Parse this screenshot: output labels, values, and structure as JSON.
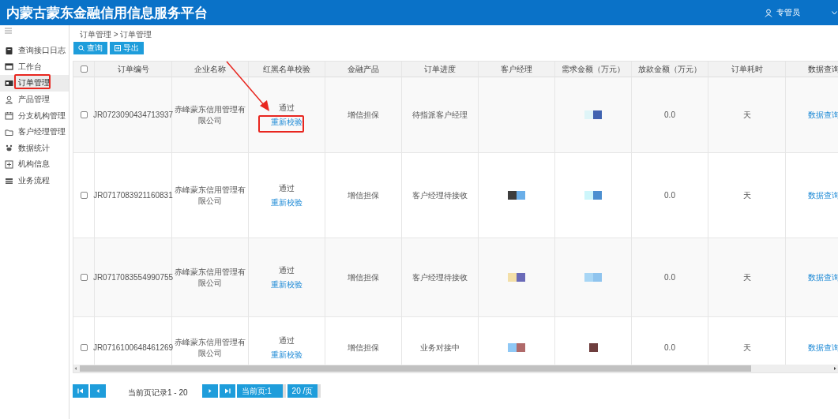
{
  "header": {
    "title": "内蒙古蒙东金融信用信息服务平台",
    "user": "专管员"
  },
  "sidebar": {
    "items": [
      {
        "label": "查询接口日志",
        "selected": false
      },
      {
        "label": "工作台",
        "selected": false
      },
      {
        "label": "订单管理",
        "selected": true
      },
      {
        "label": "产品管理",
        "selected": false
      },
      {
        "label": "分支机构管理",
        "selected": false
      },
      {
        "label": "客户经理管理",
        "selected": false
      },
      {
        "label": "数据统计",
        "selected": false
      },
      {
        "label": "机构信息",
        "selected": false
      },
      {
        "label": "业务流程",
        "selected": false
      }
    ]
  },
  "breadcrumb": "订单管理 > 订单管理",
  "toolbar": [
    {
      "label": "查询"
    },
    {
      "label": "导出"
    }
  ],
  "table": {
    "header_checked": false,
    "columns": [
      "订单编号",
      "企业名称",
      "红黑名单校验",
      "金融产品",
      "订单进度",
      "客户经理",
      "需求金额（万元）",
      "放款金额（万元）",
      "订单耗时",
      "数据查询"
    ],
    "rows": [
      {
        "checked": false,
        "order_no": "JR0723090434713937",
        "company": "赤峰蒙东信用管理有限公司",
        "check_result": "通过",
        "recheck_link": "重新校验",
        "product": "增信担保",
        "progress": "待指派客户经理",
        "manager_mosaic": [],
        "amount_mosaic": [
          {
            "color": "#dff5f8"
          },
          {
            "color": "#3f63b0"
          }
        ],
        "loan_amount": "0.0",
        "duration": "天",
        "query_link": "数据查询"
      },
      {
        "checked": false,
        "order_no": "JR0717083921160831",
        "company": "赤峰蒙东信用管理有限公司",
        "check_result": "通过",
        "recheck_link": "重新校验",
        "product": "增信担保",
        "progress": "客户经理待接收",
        "manager_mosaic": [
          {
            "color": "#3d3d3d"
          },
          {
            "color": "#6aaee8"
          }
        ],
        "amount_mosaic": [
          {
            "color": "#cdf6fb"
          },
          {
            "color": "#4b8fd0"
          }
        ],
        "loan_amount": "0.0",
        "duration": "天",
        "query_link": "数据查询"
      },
      {
        "checked": false,
        "order_no": "JR0717083554990755",
        "company": "赤峰蒙东信用管理有限公司",
        "check_result": "通过",
        "recheck_link": "重新校验",
        "product": "增信担保",
        "progress": "客户经理待接收",
        "manager_mosaic": [
          {
            "color": "#f3dfa8"
          },
          {
            "color": "#6a6ab8"
          }
        ],
        "amount_mosaic": [
          {
            "color": "#a8d6f5"
          },
          {
            "color": "#8fc4ee"
          }
        ],
        "loan_amount": "0.0",
        "duration": "天",
        "query_link": "数据查询"
      },
      {
        "checked": false,
        "order_no": "JR0716100648461269",
        "company": "赤峰蒙东信用管理有限公司",
        "check_result": "通过",
        "recheck_link": "重新校验",
        "product": "增信担保",
        "progress": "业务对接中",
        "manager_mosaic": [
          {
            "color": "#8fc8f5"
          },
          {
            "color": "#b06a6a"
          }
        ],
        "amount_mosaic": [
          {
            "color": "#6e3e3e"
          }
        ],
        "loan_amount": "0.0",
        "duration": "天",
        "query_link": "数据查询"
      }
    ]
  },
  "pagination": {
    "record_text": "当前页记录1 - 20",
    "page_select": "当前页:1",
    "size_select": "20 /页"
  }
}
